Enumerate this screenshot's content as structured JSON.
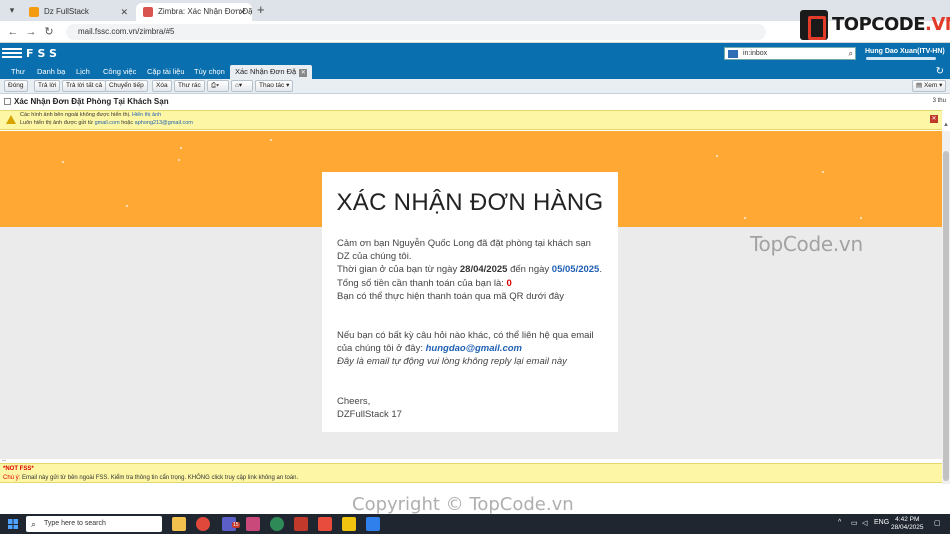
{
  "browser": {
    "tabs": [
      {
        "label": "Dz FullStack",
        "active": false
      },
      {
        "label": "Zimbra: Xác Nhận Đơn Đặt Phò",
        "active": true
      }
    ],
    "url": "mail.fssc.com.vn/zimbra/#5"
  },
  "brand_logo": {
    "text_main": "TOPCODE",
    "text_suffix": ".VN"
  },
  "zimbra": {
    "logo": "FSS",
    "search_value": "in:inbox",
    "user_name": "Hung Dao Xuan(ITV-HN)",
    "app_tabs": [
      "Thư",
      "Danh bạ",
      "Lịch",
      "Công việc",
      "Cặp tài liệu",
      "Tùy chọn",
      "Xác Nhận Đơn Đặ"
    ],
    "toolbar": {
      "close": "Đóng",
      "reply": "Trả lời",
      "reply_all": "Trả lời tất cả",
      "forward": "Chuyển tiếp",
      "delete": "Xóa",
      "spam": "Thư rác",
      "actions": "Thao tác",
      "view": "Xem"
    },
    "subject": "Xác Nhận Đơn Đặt Phòng Tại Khách Sạn",
    "time_ago": "3 thu",
    "warning": {
      "line1_text": "Các hình ảnh bên ngoài không được hiển thị.",
      "line1_link": "Hiển thị ảnh",
      "line2_text": "Luôn hiển thị ảnh được gửi từ",
      "line2_domain": "gmail.com",
      "line2_or": "hoặc",
      "line2_email": "aphong213@gmail.com"
    }
  },
  "email": {
    "title": "XÁC NHẬN ĐƠN HÀNG",
    "p1": "Cảm ơn bạn Nguyễn Quốc Long đã đặt phòng tại khách sạn DZ của chúng tôi.",
    "time_prefix": "Thời gian ở của bạn từ ngày",
    "date_from": "28/04/2025",
    "time_mid": "đến ngày",
    "date_to": "05/05/2025",
    "time_suffix": ".",
    "total_prefix": "Tổng số tiền cần thanh toán của bạn là:",
    "total_value": "0",
    "qr_line": "Bạn có thể thực hiện thanh toán qua mã QR dưới đây",
    "contact_line": "Nếu bạn có bất kỳ câu hỏi nào khác, có thể liên hệ qua email của chúng tôi ở đây:",
    "contact_email": "hungdao@gmail.com",
    "auto_line": "Đây là email tự động vui lòng không reply lại email này",
    "closing": "Cheers,",
    "signature": "DZFullStack 17"
  },
  "footer_notice": {
    "tag": "*NOT FSS*",
    "prefix": "Chú ý:",
    "text": "Email này gửi từ bên ngoài FSS. Kiểm tra thông tin cẩn trọng. KHÔNG click truy cập link không an toàn."
  },
  "watermarks": {
    "topcode": "TopCode.vn",
    "copyright": "Copyright © TopCode.vn"
  },
  "taskbar": {
    "search_placeholder": "Type here to search",
    "lang": "ENG",
    "time": "4:42 PM",
    "date": "28/04/2025",
    "badge": "15"
  },
  "colors": {
    "zimbra_blue": "#0a6fae",
    "orange_banner": "#ffa834",
    "date_blue": "#1f5fb3",
    "amount_red": "#dd0000"
  }
}
